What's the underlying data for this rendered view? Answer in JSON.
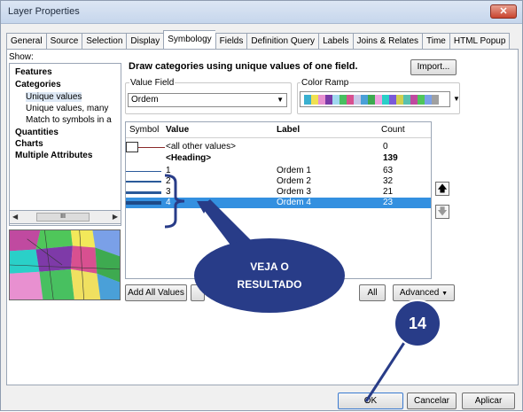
{
  "window": {
    "title": "Layer Properties",
    "close_label": "✕"
  },
  "tabs": [
    "General",
    "Source",
    "Selection",
    "Display",
    "Symbology",
    "Fields",
    "Definition Query",
    "Labels",
    "Joins & Relates",
    "Time",
    "HTML Popup"
  ],
  "active_tab": "Symbology",
  "show": {
    "label": "Show:",
    "items": [
      {
        "label": "Features",
        "bold": true
      },
      {
        "label": "Categories",
        "bold": true
      },
      {
        "label": "Unique values",
        "bold": false,
        "selected": true
      },
      {
        "label": "Unique values, many",
        "bold": false
      },
      {
        "label": "Match to symbols in a",
        "bold": false
      },
      {
        "label": "Quantities",
        "bold": true
      },
      {
        "label": "Charts",
        "bold": true
      },
      {
        "label": "Multiple Attributes",
        "bold": true
      }
    ],
    "scroll_thumb": "III"
  },
  "main": {
    "heading": "Draw categories using unique values of one field.",
    "import_button": "Import...",
    "value_field_label": "Value Field",
    "value_field_value": "Ordem",
    "color_ramp_label": "Color Ramp",
    "colors": {
      "accent": "#3390e0",
      "balloon": "#283c88",
      "symbol": "#2a5a9a"
    }
  },
  "table": {
    "headers": {
      "symbol": "Symbol",
      "value": "Value",
      "label": "Label",
      "count": "Count"
    },
    "rows": [
      {
        "value": "<all other values>",
        "label": "",
        "count": "0"
      },
      {
        "value": "<Heading>",
        "label": "",
        "count": "139"
      },
      {
        "value": "1",
        "label": "Ordem 1",
        "count": "63"
      },
      {
        "value": "2",
        "label": "Ordem 2",
        "count": "32"
      },
      {
        "value": "3",
        "label": "Ordem 3",
        "count": "21"
      },
      {
        "value": "4",
        "label": "Ordem 4",
        "count": "23"
      }
    ]
  },
  "buttons": {
    "add_all_values": "Add All Values",
    "all": "All",
    "advanced": "Advanced",
    "ok": "OK",
    "cancel": "Cancelar",
    "apply": "Aplicar"
  },
  "annotations": {
    "balloon_line1": "VEJA O",
    "balloon_line2": "RESULTADO",
    "step_number": "14"
  }
}
